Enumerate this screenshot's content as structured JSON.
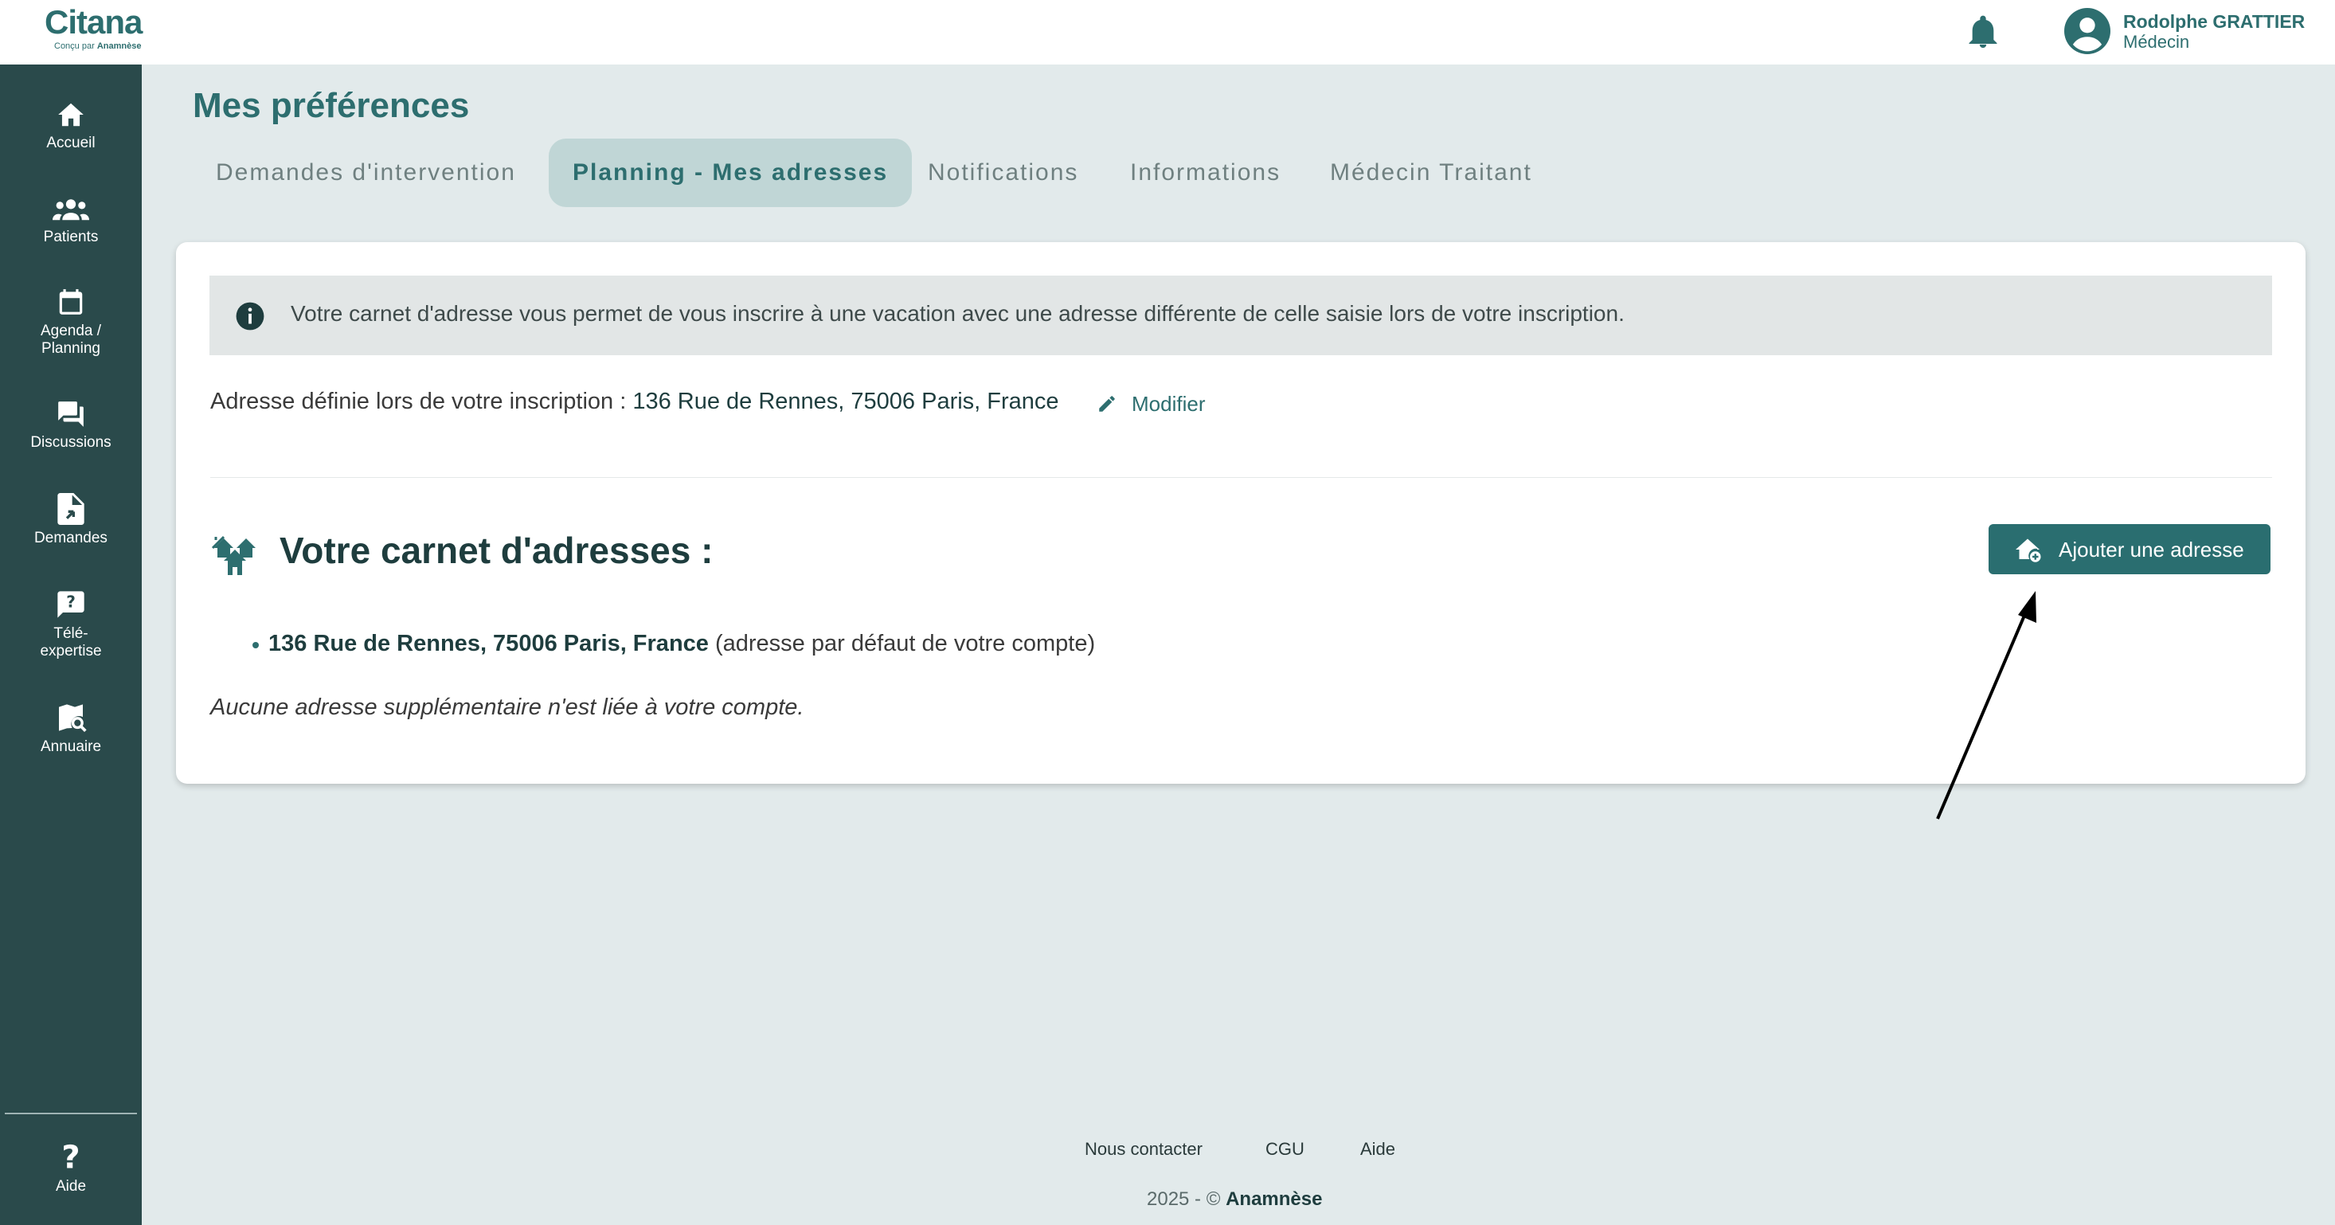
{
  "brand": {
    "name": "Citana",
    "tagline_prefix": "Conçu par",
    "tagline_brand": "Anamnèse"
  },
  "user": {
    "name": "Rodolphe GRATTIER",
    "role": "Médecin"
  },
  "sidebar": {
    "items": [
      {
        "label": "Accueil",
        "icon": "home-icon"
      },
      {
        "label": "Patients",
        "icon": "users-icon"
      },
      {
        "label": "Agenda / Planning",
        "icon": "calendar-icon"
      },
      {
        "label": "Discussions",
        "icon": "chat-icon"
      },
      {
        "label": "Demandes",
        "icon": "document-icon"
      },
      {
        "label": "Télé-expertise",
        "icon": "question-bubble-icon"
      },
      {
        "label": "Annuaire",
        "icon": "map-search-icon"
      }
    ],
    "help": "Aide"
  },
  "page": {
    "title": "Mes préférences",
    "tabs": [
      {
        "label": "Demandes d'intervention",
        "active": false
      },
      {
        "label": "Planning - Mes adresses",
        "active": true
      },
      {
        "label": "Notifications",
        "active": false
      },
      {
        "label": "Informations",
        "active": false
      },
      {
        "label": "Médecin Traitant",
        "active": false
      }
    ]
  },
  "addresses": {
    "info_text": "Votre carnet d'adresse vous permet de vous inscrire à une vacation avec une adresse différente de celle saisie lors de votre inscription.",
    "registration_label": "Adresse définie lors de votre inscription :",
    "registration_value": "136 Rue de Rennes, 75006 Paris, France",
    "modify_label": "Modifier",
    "book_title": "Votre carnet d'adresses :",
    "add_button": "Ajouter une adresse",
    "default_address": "136 Rue de Rennes, 75006 Paris, France",
    "default_note": "(adresse par défaut de votre compte)",
    "empty_note": "Aucune adresse supplémentaire n'est liée à votre compte."
  },
  "footer": {
    "links": [
      "Nous contacter",
      "CGU",
      "Aide"
    ],
    "copyright_prefix": "2025 - ©",
    "copyright_brand": "Anamnèse"
  },
  "colors": {
    "sidebar_bg": "#2a4a4b",
    "accent": "#2d6e6f",
    "button_bg": "#2a6e70",
    "page_bg": "#e2eaeb",
    "active_tab_bg": "#c0d6d6"
  }
}
